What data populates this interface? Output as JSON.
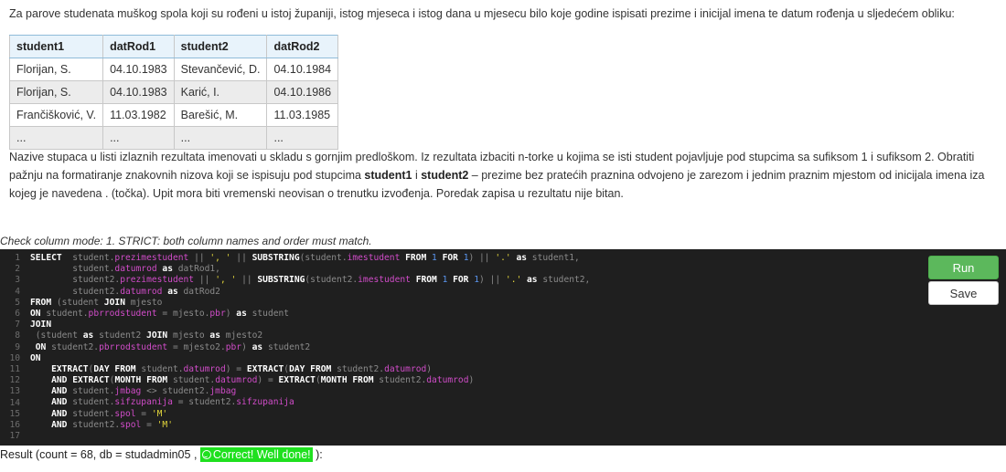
{
  "task_text": "Za parove studenata muškog spola koji su rođeni u istoj županiji, istog mjeseca i istog dana u mjesecu bilo koje godine ispisati prezime i inicijal imena te datum rođenja u sljedećem obliku:",
  "example_table": {
    "headers": [
      "student1",
      "datRod1",
      "student2",
      "datRod2"
    ],
    "rows": [
      [
        "Florijan, S.",
        "04.10.1983",
        "Stevančević, D.",
        "04.10.1984"
      ],
      [
        "Florijan, S.",
        "04.10.1983",
        "Karić, I.",
        "04.10.1986"
      ],
      [
        "Frančišković, V.",
        "11.03.1982",
        "Barešić, M.",
        "11.03.1985"
      ],
      [
        "...",
        "...",
        "...",
        "..."
      ]
    ]
  },
  "notes": {
    "part1": "Nazive stupaca u listi izlaznih rezultata imenovati u skladu s gornjim predloškom. Iz rezultata izbaciti n-torke u kojima se isti student pojavljuje pod stupcima sa sufiksom 1 i sufiksom 2. Obratiti pažnju na formatiranje znakovnih nizova koji se ispisuju pod stupcima ",
    "bold1": "student1",
    "mid": " i ",
    "bold2": "student2",
    "part2": " – prezime bez pratećih praznina odvojeno je zarezom i jednim praznim mjestom od inicijala imena iza kojeg je navedena . (točka). Upit mora biti vremenski neovisan o trenutku izvođenja. Poredak zapisa u rezultatu nije bitan."
  },
  "check_mode": "Check column mode: 1. STRICT: both column names and order must match.",
  "editor": {
    "line_numbers": [
      "1",
      "2",
      "3",
      "4",
      "5",
      "6",
      "7",
      "8",
      "9",
      "10",
      "11",
      "12",
      "13",
      "14",
      "15",
      "16",
      "17"
    ]
  },
  "buttons": {
    "run": "Run",
    "save": "Save"
  },
  "result": {
    "prefix": "Result (count = 68, db = studadmin05 , ",
    "status": "Correct! Well done!",
    "suffix": " ):",
    "status_color": "#1fe01f"
  },
  "colors": {
    "run_button": "#5cb85c",
    "editor_bg": "#1f1f1f",
    "keyword": "#ffffff",
    "field": "#d04cc8",
    "string": "#e3d63b",
    "number": "#5b96f0"
  }
}
